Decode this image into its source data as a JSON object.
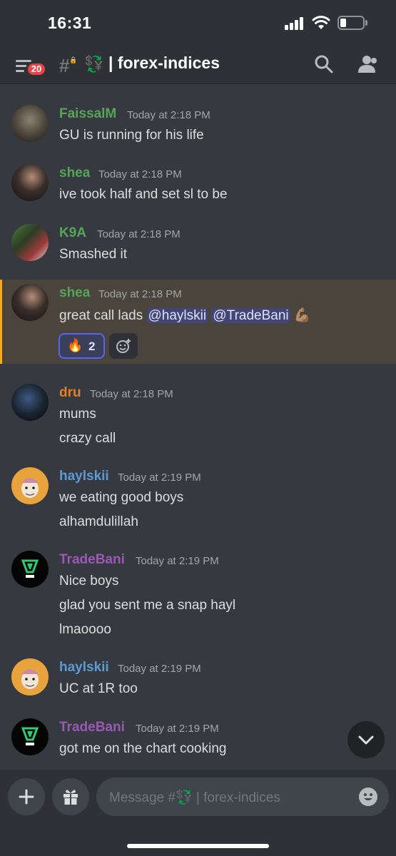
{
  "status_bar": {
    "time": "16:31"
  },
  "header": {
    "badge_count": "20",
    "channel_prefix_icon": "hash-lock-icon",
    "channel_emoji": "💱",
    "channel_name": "| forex-indices"
  },
  "messages": [
    {
      "username": "FaissalM",
      "color": "#57a55a",
      "timestamp": "Today at 2:18 PM",
      "lines": [
        "GU is running for his life"
      ]
    },
    {
      "username": "shea",
      "color": "#57a55a",
      "timestamp": "Today at 2:18 PM",
      "lines": [
        "ive took half and set sl to be"
      ]
    },
    {
      "username": "K9A",
      "color": "#57a55a",
      "timestamp": "Today at 2:18 PM",
      "lines": [
        "Smashed it"
      ]
    },
    {
      "username": "shea",
      "color": "#57a55a",
      "timestamp": "Today at 2:18 PM",
      "lines": [
        "great call lads"
      ],
      "mentions": [
        "@haylskii",
        "@TradeBani"
      ],
      "emoji": "💪🏽",
      "reaction": {
        "emoji": "🔥",
        "count": "2"
      }
    },
    {
      "username": "dru",
      "color": "#e67e22",
      "timestamp": "Today at 2:18 PM",
      "lines": [
        "mums",
        "crazy call"
      ]
    },
    {
      "username": "haylskii",
      "color": "#5b9bd5",
      "timestamp": "Today at 2:19 PM",
      "lines": [
        "we eating good boys",
        "alhamdulillah"
      ]
    },
    {
      "username": "TradeBani",
      "color": "#9b59b6",
      "timestamp": "Today at 2:19 PM",
      "lines": [
        "Nice boys",
        "glad you sent me a snap hayl",
        "lmaoooo"
      ]
    },
    {
      "username": "haylskii",
      "color": "#5b9bd5",
      "timestamp": "Today at 2:19 PM",
      "lines": [
        "UC at 1R too"
      ]
    },
    {
      "username": "TradeBani",
      "color": "#9b59b6",
      "timestamp": "Today at 2:19 PM",
      "lines": [
        "got me on the chart cooking"
      ]
    }
  ],
  "composer": {
    "placeholder_prefix": "Message #",
    "placeholder_emoji": "💱",
    "placeholder_channel": " | forex-indices"
  }
}
